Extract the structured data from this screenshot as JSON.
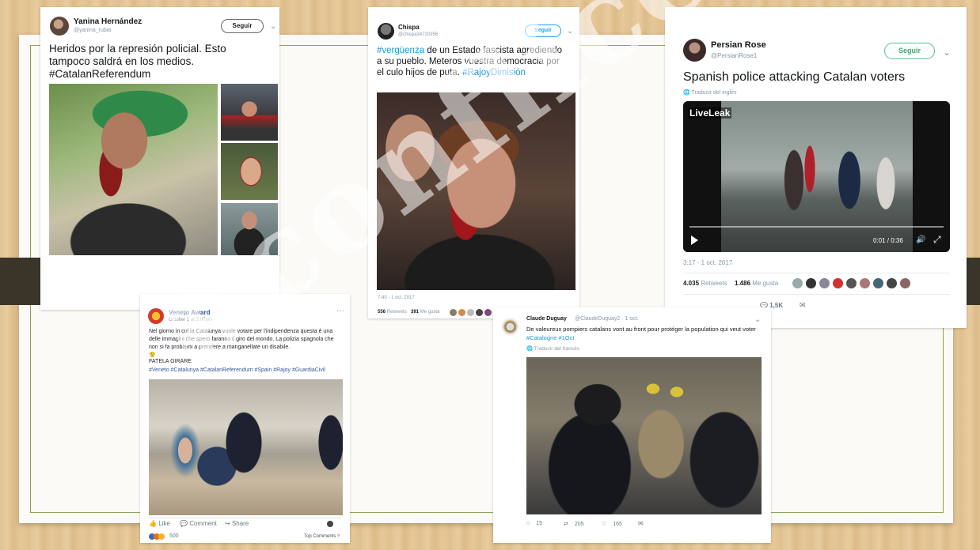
{
  "tweet1": {
    "name": "Yanina Hernández",
    "handle": "@yanina_rubia",
    "follow_label": "Seguir",
    "text": "Heridos por la represión policial. Esto tampoco saldrá en los medios.",
    "hashtag": "#CatalanReferendum"
  },
  "tweet2": {
    "name": "Chispa",
    "handle": "@chispa34720356",
    "follow_label": "Seguir",
    "hashtag1": "#vergüenza",
    "text": " de un Estado fascista agrediendo a su pueblo. Meteros vuestra democracia por el culo hijos de puta.",
    "hashtag2": "#RajoyDimisión",
    "time": "7:40 - 1 oct. 2017",
    "retweets_count": "556",
    "retweets_label": "Retweets",
    "likes_count": "391",
    "likes_label": "Me gusta"
  },
  "tweet3": {
    "name": "Persian Rose",
    "handle": "@PersianRose1",
    "follow_label": "Seguir",
    "text": "Spanish police attacking Catalan voters",
    "translate": "Traducir del inglés",
    "video_logo": "LiveLeak",
    "video_time": "0:01 / 0:36",
    "time": "3:17 - 1 oct. 2017",
    "retweets_count": "4.035",
    "retweets_label": "Retweets",
    "likes_count": "1.486",
    "likes_label": "Me gusta",
    "reply_count": "1,5K"
  },
  "fb_post": {
    "name": "Veneto Award",
    "meta": "October 1 at 3:07pm ·",
    "text": "Nel giorno in cui la Catalunya vuole votare per l'indipendenza questa è una delle immagini che spero faranno il giro del mondo. La polizia spagnola che non si fa problemi a prendere a manganellate un disabile.",
    "emoji": "😤",
    "shout": "FATELA GIRARE",
    "hashtags": "#Veneto #Catalunya #CatalanReferendum #Spain #Rajoy #GuardiaCivil",
    "like_label": "Like",
    "comment_label": "Comment",
    "share_label": "Share",
    "reactions_count": "500",
    "top_comments": "Top Comments ˅"
  },
  "tweet4": {
    "name": "Claude Duguay",
    "handle_date": "@ClaudeDuguay2 · 1 oct.",
    "text": "De valeureux pompiers catalans vont au front pour protéger la population qui veut voter ",
    "hashtags": "#Catalogne #1Oct",
    "translate": "Traducir del francés",
    "replies": "15",
    "retweets": "205",
    "likes": "165"
  },
  "watermark": "#conflicencial",
  "icons": {
    "chevron": "chevron-down-icon",
    "globe": "globe-icon",
    "play": "play-icon",
    "volume": "volume-icon",
    "fullscreen": "fullscreen-icon",
    "reply": "reply-icon",
    "retweet": "retweet-icon",
    "heart": "heart-icon",
    "message": "message-icon",
    "like": "thumbs-up-icon",
    "comment": "comment-icon",
    "share": "share-icon"
  },
  "colors": {
    "twitter_blue": "#1b95e0",
    "follow_green": "#4fc38a",
    "frame_green": "#8fa35a",
    "facebook_blue": "#4267b2"
  }
}
